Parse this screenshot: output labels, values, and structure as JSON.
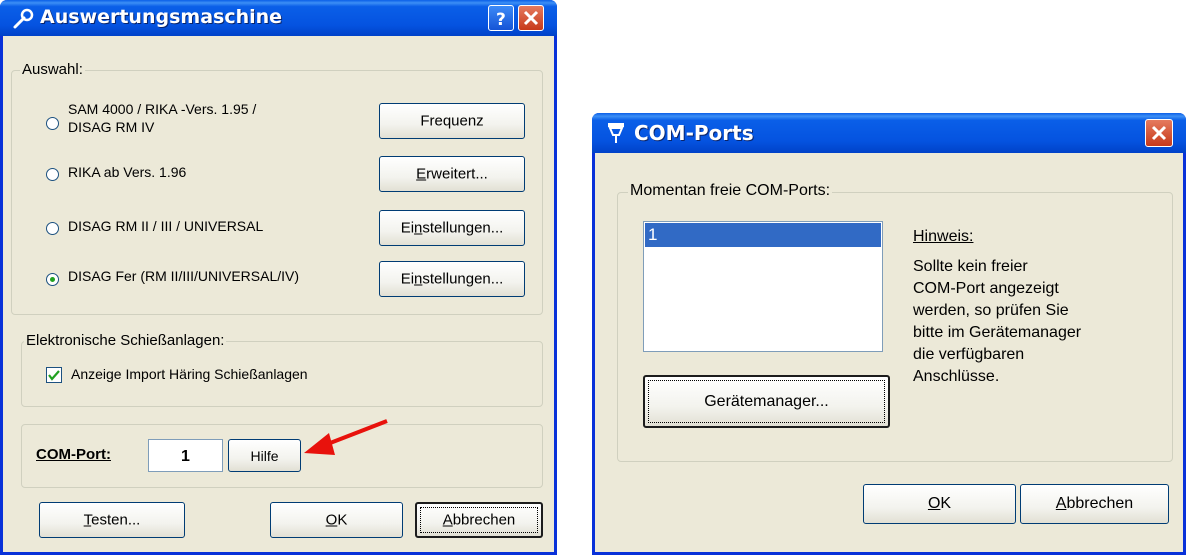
{
  "dialog1": {
    "title": "Auswertungsmaschine",
    "auswahl_label": "Auswahl:",
    "options": [
      {
        "line1": "SAM 4000 / RIKA -Vers. 1.95 /",
        "line2": "DISAG RM IV",
        "button": "Frequenz",
        "selected": false
      },
      {
        "line1": "RIKA ab Vers. 1.96",
        "line2": "",
        "button_u": "E",
        "button_rest": "rweitert...",
        "selected": false
      },
      {
        "line1": "DISAG RM II / III / UNIVERSAL",
        "line2": "",
        "button_a": "Ei",
        "button_u": "n",
        "button_b": "stellungen...",
        "selected": false
      },
      {
        "line1": "DISAG Fer (RM II/III/UNIVERSAL/IV)",
        "line2": "",
        "button_a": "Ei",
        "button_u": "n",
        "button_b": "stellungen...",
        "selected": true
      }
    ],
    "elektro_label": "Elektronische Schießanlagen:",
    "checkbox_label": "Anzeige Import Häring Schießanlagen",
    "checkbox_checked": true,
    "com_label": "COM-Port:",
    "com_value": "1",
    "hilfe": "Hilfe",
    "testen_u": "T",
    "testen_rest": "esten...",
    "ok_u": "O",
    "ok_rest": "K",
    "abbrechen_u": "A",
    "abbrechen_rest": "bbrechen"
  },
  "dialog2": {
    "title": "COM-Ports",
    "group_label": "Momentan freie COM-Ports:",
    "ports": [
      "1"
    ],
    "hinweis_title": "Hinweis:",
    "hinweis_lines": [
      "Sollte kein freier",
      "COM-Port angezeigt",
      "werden, so prüfen Sie",
      "bitte im Gerätemanager",
      "die verfügbaren",
      "Anschlüsse."
    ],
    "geraete": "Gerätemanager...",
    "ok_u": "O",
    "ok_rest": "K",
    "abbrechen_u": "A",
    "abbrechen_rest": "bbrechen"
  },
  "colors": {
    "titlebar": "#0553e0",
    "face": "#ece9d8",
    "selection": "#316ac5",
    "arrow": "#e8120c"
  }
}
